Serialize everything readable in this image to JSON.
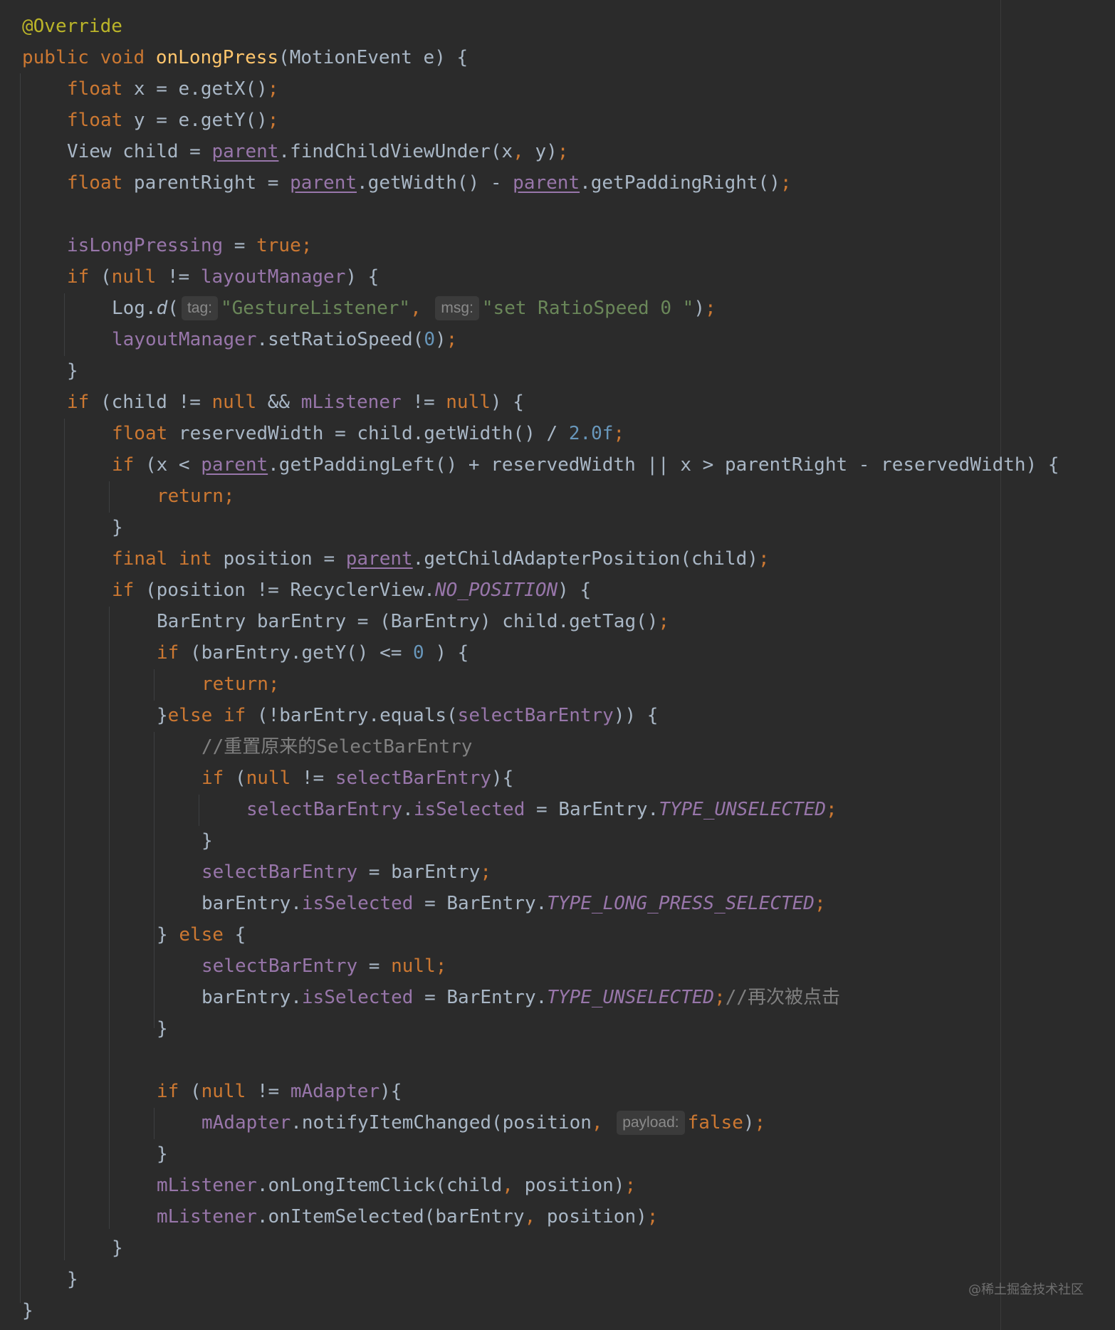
{
  "editor": {
    "lines": {
      "l1": {
        "annotation": "@Override"
      },
      "l2": {
        "kw_public": "public",
        "kw_void": "void",
        "method": "onLongPress",
        "params": "(MotionEvent e) {"
      },
      "l3": {
        "kw": "float",
        "code": " x = e.getX()",
        "semi": ";"
      },
      "l4": {
        "kw": "float",
        "code": " y = e.getY()",
        "semi": ";"
      },
      "l5": {
        "pre": "View child = ",
        "parent": "parent",
        "mid": ".findChildViewUnder(x",
        "comma": ",",
        "post": " y)",
        "semi": ";"
      },
      "l6": {
        "kw": "float",
        "pre": " parentRight = ",
        "parent1": "parent",
        "mid": ".getWidth() - ",
        "parent2": "parent",
        "post": ".getPaddingRight()",
        "semi": ";"
      },
      "l7": {
        "field": "isLongPressing",
        "eq": " = ",
        "kw_true": "true",
        "semi": ";"
      },
      "l8": {
        "kw_if": "if",
        "open": " (",
        "kw_null": "null",
        "op": " != ",
        "field": "layoutManager",
        "close": ") {"
      },
      "l9": {
        "pre": "Log.",
        "method": "d",
        "open": "(",
        "hint_tag": "tag:",
        "str_tag": "\"GestureListener\"",
        "comma": ",",
        "hint_msg": "msg:",
        "str_msg": "\"set RatioSpeed 0 \"",
        "close": ")",
        "semi": ";"
      },
      "l10": {
        "field": "layoutManager",
        "pre": ".setRatioSpeed(",
        "num": "0",
        "close": ")",
        "semi": ";"
      },
      "l11": {
        "brace": "}"
      },
      "l12": {
        "kw_if": "if",
        "pre": " (child != ",
        "kw_null1": "null",
        "and": " && ",
        "field": "mListener",
        "op": " != ",
        "kw_null2": "null",
        "close": ") {"
      },
      "l13": {
        "kw": "float",
        "pre": " reservedWidth = child.getWidth() / ",
        "num": "2.0f",
        "semi": ";"
      },
      "l14": {
        "kw_if": "if",
        "pre": " (x < ",
        "parent": "parent",
        "post": ".getPaddingLeft() + reservedWidth || x > parentRight - reservedWidth) {"
      },
      "l15": {
        "kw_return": "return",
        "semi": ";"
      },
      "l16": {
        "brace": "}"
      },
      "l17": {
        "kw_final": "final",
        "kw_int": "int",
        "pre": " position = ",
        "parent": "parent",
        "post": ".getChildAdapterPosition(child)",
        "semi": ";"
      },
      "l18": {
        "kw_if": "if",
        "pre": " (position != RecyclerView.",
        "const": "NO_POSITION",
        "post": ") {"
      },
      "l19": {
        "code": "BarEntry barEntry = (BarEntry) child.getTag()",
        "semi": ";"
      },
      "l20": {
        "kw_if": "if",
        "pre": " (barEntry.getY() <= ",
        "num": "0",
        "post": " ) {"
      },
      "l21": {
        "kw_return": "return",
        "semi": ";"
      },
      "l22": {
        "brace": "}",
        "kw_else": "else",
        "kw_if": "if",
        "pre": " (!barEntry.equals(",
        "field": "selectBarEntry",
        "post": ")) {"
      },
      "l23": {
        "comment": "//重置原来的SelectBarEntry"
      },
      "l24": {
        "kw_if": "if",
        "open": " (",
        "kw_null": "null",
        "op": " != ",
        "field": "selectBarEntry",
        "close": "){"
      },
      "l25": {
        "field1": "selectBarEntry",
        "dot": ".",
        "field2": "isSelected",
        "pre": " = BarEntry.",
        "const": "TYPE_UNSELECTED",
        "semi": ";"
      },
      "l26": {
        "brace": "}"
      },
      "l27": {
        "field": "selectBarEntry",
        "post": " = barEntry",
        "semi": ";"
      },
      "l28": {
        "pre": "barEntry.",
        "field": "isSelected",
        "mid": " = BarEntry.",
        "const": "TYPE_LONG_PRESS_SELECTED",
        "semi": ";"
      },
      "l29": {
        "brace": "} ",
        "kw_else": "else",
        "post": " {"
      },
      "l30": {
        "field": "selectBarEntry",
        "eq": " = ",
        "kw_null": "null",
        "semi": ";"
      },
      "l31": {
        "pre": "barEntry.",
        "field": "isSelected",
        "mid": " = BarEntry.",
        "const": "TYPE_UNSELECTED",
        "semi": ";",
        "comment": "//再次被点击"
      },
      "l32": {
        "brace": "}"
      },
      "l33": {
        "kw_if": "if",
        "open": " (",
        "kw_null": "null",
        "op": " != ",
        "field": "mAdapter",
        "close": "){"
      },
      "l34": {
        "field": "mAdapter",
        "pre": ".notifyItemChanged(position",
        "comma": ",",
        "hint_payload": "payload:",
        "kw_false": "false",
        "close": ")",
        "semi": ";"
      },
      "l35": {
        "brace": "}"
      },
      "l36": {
        "field": "mListener",
        "pre": ".onLongItemClick(child",
        "comma": ",",
        "post": " position)",
        "semi": ";"
      },
      "l37": {
        "field": "mListener",
        "pre": ".onItemSelected(barEntry",
        "comma": ",",
        "post": " position)",
        "semi": ";"
      },
      "l38": {
        "brace": "}"
      },
      "l39": {
        "brace": "}"
      },
      "l40": {
        "brace": "}"
      }
    }
  },
  "watermark": "@稀土掘金技术社区",
  "colors": {
    "background": "#2b2b2b",
    "default_text": "#a9b7c6",
    "keyword": "#cc7832",
    "annotation": "#bbb529",
    "method_declaration": "#ffc66d",
    "string": "#6a8759",
    "number": "#6897bb",
    "field": "#9876aa",
    "comment": "#808080"
  }
}
